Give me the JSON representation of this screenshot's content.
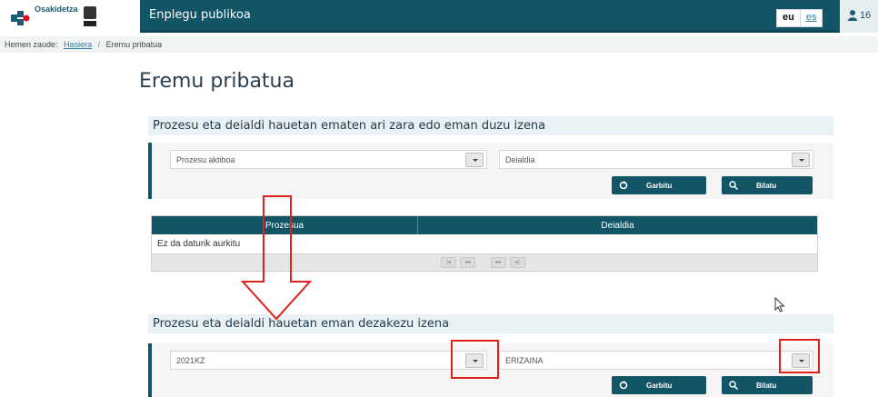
{
  "brand": {
    "name": "Osakidetza"
  },
  "header": {
    "title": "Enplegu publikoa",
    "languages": [
      "eu",
      "es"
    ],
    "user_count": "16"
  },
  "breadcrumb": {
    "prefix": "Hemen zaude:",
    "home": "Hasiera",
    "separator": "/",
    "current": "Eremu pribatua"
  },
  "page_title": "Eremu pribatua",
  "section1": {
    "heading": "Prozesu eta deialdi hauetan ematen ari zara edo eman duzu izena",
    "process_select": "Prozesu aktiboa",
    "call_select": "Deialdia",
    "clear_label": "Garbitu",
    "search_label": "Bilatu",
    "table": {
      "columns": [
        "Prozesua",
        "Deialdia"
      ],
      "empty_text": "Ez da daturik aurkitu",
      "pager": [
        "|◂",
        "◂◂",
        "▸▸",
        "▸|"
      ]
    }
  },
  "section2": {
    "heading": "Prozesu eta deialdi hauetan eman dezakezu izena",
    "process_select": "2021KZ",
    "call_select": "ERIZAINA",
    "clear_label": "Garbitu",
    "search_label": "Bilatu"
  },
  "colors": {
    "primary": "#115566",
    "annotation": "#e0201b",
    "section_bg": "#e9f1f4"
  }
}
